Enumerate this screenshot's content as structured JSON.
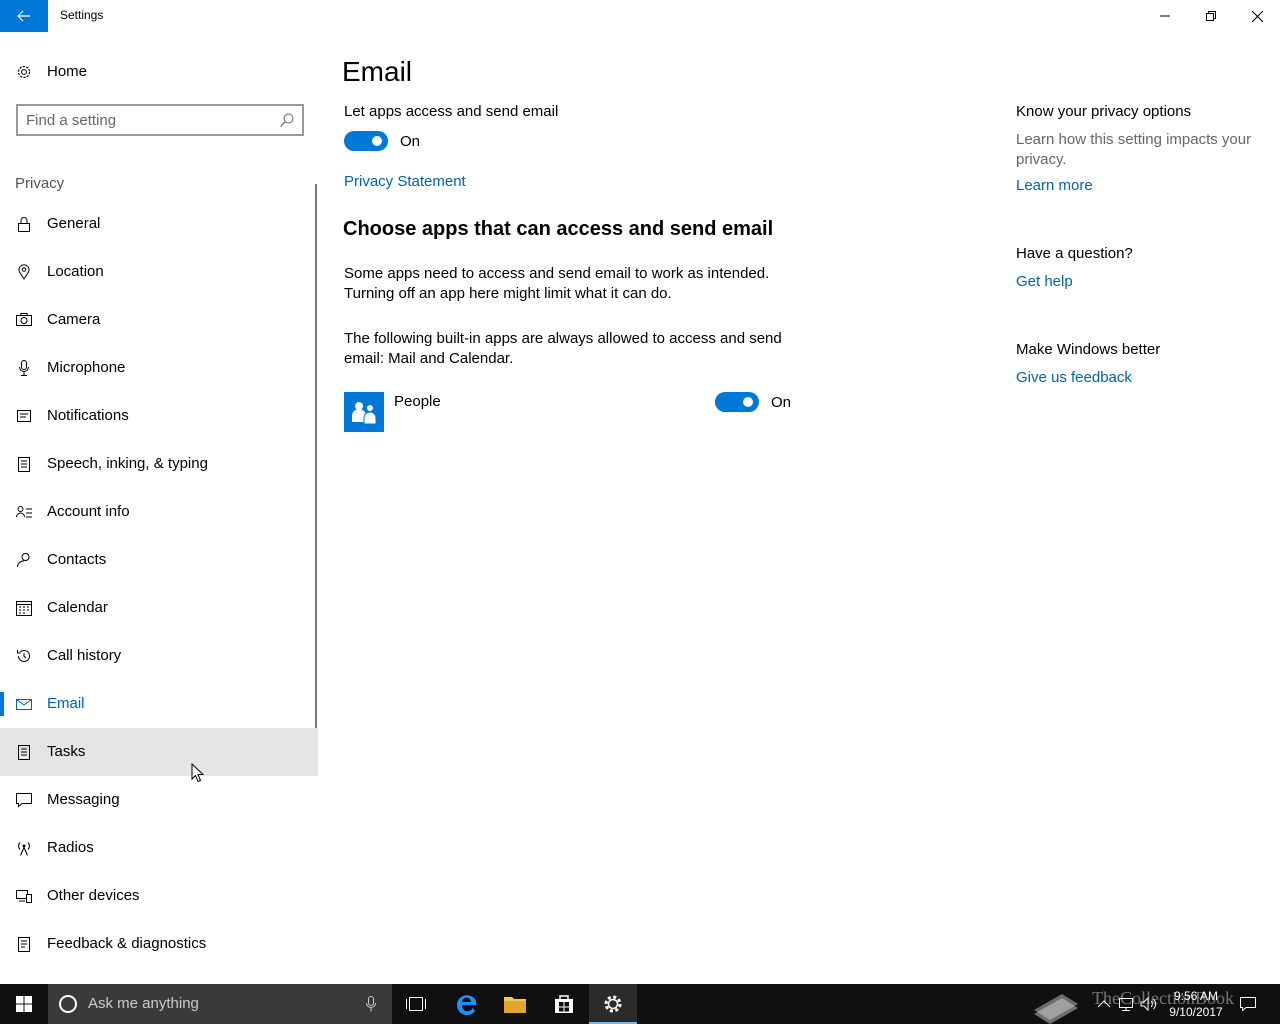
{
  "window": {
    "title": "Settings"
  },
  "sidebar": {
    "home_label": "Home",
    "search_placeholder": "Find a setting",
    "section_label": "Privacy",
    "items": [
      {
        "label": "General",
        "icon": "lock-icon"
      },
      {
        "label": "Location",
        "icon": "location-icon"
      },
      {
        "label": "Camera",
        "icon": "camera-icon"
      },
      {
        "label": "Microphone",
        "icon": "microphone-icon"
      },
      {
        "label": "Notifications",
        "icon": "notifications-icon"
      },
      {
        "label": "Speech, inking, & typing",
        "icon": "speech-icon"
      },
      {
        "label": "Account info",
        "icon": "account-info-icon"
      },
      {
        "label": "Contacts",
        "icon": "contacts-icon"
      },
      {
        "label": "Calendar",
        "icon": "calendar-icon"
      },
      {
        "label": "Call history",
        "icon": "history-icon"
      },
      {
        "label": "Email",
        "icon": "mail-icon",
        "active": true
      },
      {
        "label": "Tasks",
        "icon": "tasks-icon",
        "hover": true
      },
      {
        "label": "Messaging",
        "icon": "messaging-icon"
      },
      {
        "label": "Radios",
        "icon": "radios-icon"
      },
      {
        "label": "Other devices",
        "icon": "devices-icon"
      },
      {
        "label": "Feedback & diagnostics",
        "icon": "feedback-icon"
      }
    ]
  },
  "main": {
    "title": "Email",
    "master_toggle_caption": "Let apps access and send email",
    "master_toggle_state": "On",
    "privacy_statement_link": "Privacy Statement",
    "choose_heading": "Choose apps that can access and send email",
    "para1": "Some apps need to access and send email to work as intended. Turning off an app here might limit what it can do.",
    "para2": "The following built-in apps are always allowed to access and send email: Mail and Calendar.",
    "apps": [
      {
        "name": "People",
        "state": "On"
      }
    ]
  },
  "right": {
    "privacy_heading": "Know your privacy options",
    "privacy_text": "Learn how this setting impacts your privacy.",
    "learn_more": "Learn more",
    "question_heading": "Have a question?",
    "get_help": "Get help",
    "better_heading": "Make Windows better",
    "feedback_link": "Give us feedback"
  },
  "taskbar": {
    "search_placeholder": "Ask me anything",
    "time": "9:56 AM",
    "date": "9/10/2017",
    "watermark": "TheCollectionBook"
  },
  "colors": {
    "accent": "#0078d7",
    "link": "#0063b1",
    "taskbar": "#101010"
  }
}
